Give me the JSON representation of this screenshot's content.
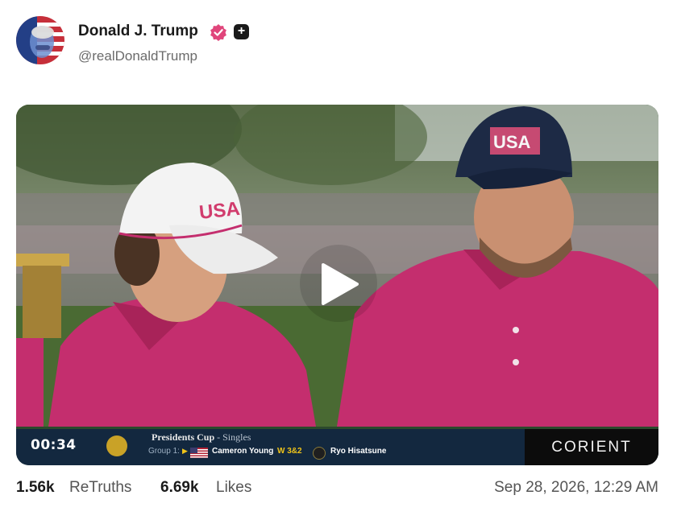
{
  "post": {
    "author": {
      "display_name": "Donald J. Trump",
      "handle": "@realDonaldTrump",
      "verified_icon": "verified-badge-icon",
      "verified_color": "#e0457b",
      "extra_badge_icon": "plus-badge-icon",
      "extra_badge_text": "+"
    },
    "video": {
      "timestamp": "00:34",
      "play_icon": "play-icon",
      "scorebug": {
        "event": "Presidents Cup",
        "format": "- Singles",
        "group": "Group 1:",
        "player1": "Cameron Young",
        "result": "W 3&2",
        "player2": "Ryo Hisatsune",
        "sponsor": "CORIENT"
      }
    },
    "stats": {
      "retruths_count": "1.56k",
      "retruths_label": "ReTruths",
      "likes_count": "6.69k",
      "likes_label": "Likes"
    },
    "date": "Sep 28, 2026, 12:29 AM"
  },
  "colors": {
    "shirt": "#c42e6e",
    "scorebar": "#13283f",
    "accent_gold": "#f0c419"
  }
}
